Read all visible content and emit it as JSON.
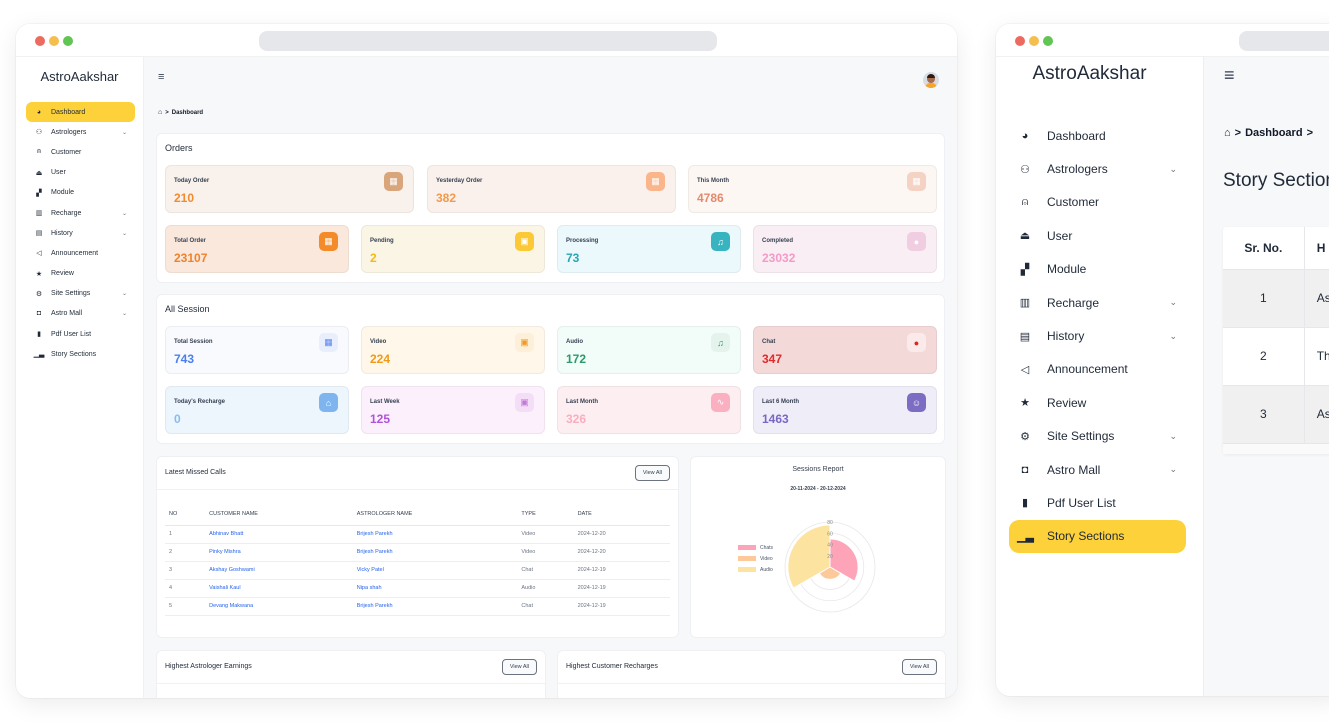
{
  "app": {
    "brand": "AstroAakshar"
  },
  "sidebar": {
    "items": [
      {
        "label": "Dashboard",
        "icon": "tachometer-icon",
        "glyph": "◕",
        "expandable": false
      },
      {
        "label": "Astrologers",
        "icon": "users-icon",
        "glyph": "⚇",
        "expandable": true
      },
      {
        "label": "Customer",
        "icon": "user-tie-icon",
        "glyph": "⍝",
        "expandable": false
      },
      {
        "label": "User",
        "icon": "user-icon",
        "glyph": "⏏",
        "expandable": false
      },
      {
        "label": "Module",
        "icon": "sitemap-icon",
        "glyph": "▞",
        "expandable": false
      },
      {
        "label": "Recharge",
        "icon": "money-icon",
        "glyph": "▥",
        "expandable": true
      },
      {
        "label": "History",
        "icon": "clipboard-history-icon",
        "glyph": "▤",
        "expandable": true
      },
      {
        "label": "Announcement",
        "icon": "megaphone-icon",
        "glyph": "◁",
        "expandable": false
      },
      {
        "label": "Review",
        "icon": "star-icon",
        "glyph": "★",
        "expandable": false
      },
      {
        "label": "Site Settings",
        "icon": "gear-icon",
        "glyph": "⚙",
        "expandable": true
      },
      {
        "label": "Astro Mall",
        "icon": "shield-icon",
        "glyph": "◘",
        "expandable": true
      },
      {
        "label": "Pdf User List",
        "icon": "file-icon",
        "glyph": "▮",
        "expandable": false
      },
      {
        "label": "Story Sections",
        "icon": "bar-chart-icon",
        "glyph": "▁▃",
        "expandable": false
      }
    ],
    "chevron": "⌄"
  },
  "windowA": {
    "active_item": "Dashboard",
    "menu_glyph": "≡",
    "breadcrumb": {
      "home_glyph": "⌂",
      "separator": ">",
      "items": [
        "Dashboard"
      ]
    },
    "orders": {
      "title": "Orders",
      "cards": [
        {
          "label": "Today Order",
          "value": "210",
          "icon": "calendar-icon",
          "glyph": "▦",
          "bg": "#f8f1ec",
          "color": "#f08b2f",
          "icon_bg": "#d9a57a"
        },
        {
          "label": "Yesterday Order",
          "value": "382",
          "icon": "calendar-icon",
          "glyph": "▦",
          "bg": "#fbf1ec",
          "color": "#f29a4a",
          "icon_bg": "#fbb58a"
        },
        {
          "label": "This Month",
          "value": "4786",
          "icon": "calendar-icon",
          "glyph": "▦",
          "bg": "#fdf7f4",
          "color": "#e48a6b",
          "icon_bg": "#f4d3c5"
        },
        {
          "label": "Total Order",
          "value": "23107",
          "icon": "calendar-icon",
          "glyph": "▦",
          "bg": "#fae8dc",
          "color": "#f0822a",
          "icon_bg": "#f38b2b"
        },
        {
          "label": "Pending",
          "value": "2",
          "icon": "video-icon",
          "glyph": "▣",
          "bg": "#fbf5e6",
          "color": "#f6b90f",
          "icon_bg": "#fbc938"
        },
        {
          "label": "Processing",
          "value": "73",
          "icon": "audio-file-icon",
          "glyph": "♫",
          "bg": "#ebf8fc",
          "color": "#27a7b5",
          "icon_bg": "#38b3c0"
        },
        {
          "label": "Completed",
          "value": "23032",
          "icon": "chat-icon",
          "glyph": "●",
          "bg": "#f9eef4",
          "color": "#f59ac8",
          "icon_bg": "#f1cde2"
        }
      ]
    },
    "sessions": {
      "title": "All Session",
      "cards": [
        {
          "label": "Total Session",
          "value": "743",
          "icon": "calendar-icon",
          "glyph": "▦",
          "bg": "#f8fafd",
          "color": "#4a7ff0",
          "icon_bg": "#e8eefb",
          "icon_fg": "#5b86f0"
        },
        {
          "label": "Video",
          "value": "224",
          "icon": "video-icon",
          "glyph": "▣",
          "bg": "#fef7ea",
          "color": "#f09a16",
          "icon_bg": "#fdefd8",
          "icon_fg": "#f39a20"
        },
        {
          "label": "Audio",
          "value": "172",
          "icon": "audio-file-icon",
          "glyph": "♫",
          "bg": "#f2fcf8",
          "color": "#2a9b6c",
          "icon_bg": "#e4f4ec",
          "icon_fg": "#2a9b6c"
        },
        {
          "label": "Chat",
          "value": "347",
          "icon": "chat-icon",
          "glyph": "●",
          "bg": "#f4d9d9",
          "color": "#e12a2a",
          "icon_bg": "#fbeaea",
          "icon_fg": "#e02424"
        },
        {
          "label": "Today's Recharge",
          "value": "0",
          "icon": "bank-icon",
          "glyph": "⌂",
          "bg": "#edf5fd",
          "color": "#86bdf0",
          "icon_bg": "#7fb5ee",
          "icon_fg": "#ffffff"
        },
        {
          "label": "Last Week",
          "value": "125",
          "icon": "calendar-play-icon",
          "glyph": "▣",
          "bg": "#fbf0fc",
          "color": "#b053d8",
          "icon_bg": "#f4def7",
          "icon_fg": "#c47ad8"
        },
        {
          "label": "Last Month",
          "value": "326",
          "icon": "trend-line-icon",
          "glyph": "∿",
          "bg": "#fdeff1",
          "color": "#f8aec0",
          "icon_bg": "#fbb0c1",
          "icon_fg": "#ffffff"
        },
        {
          "label": "Last 6 Month",
          "value": "1463",
          "icon": "support-agent-icon",
          "glyph": "☺",
          "bg": "#efedf8",
          "color": "#7a66c4",
          "icon_bg": "#7d6cc4",
          "icon_fg": "#ffffff"
        }
      ]
    },
    "missed_calls": {
      "title": "Latest Missed Calls",
      "view_all": "View All",
      "columns": [
        "NO",
        "CUSTOMER NAME",
        "ASTROLOGER NAME",
        "TYPE",
        "DATE"
      ],
      "rows": [
        [
          "1",
          "Abhinav Bhatt",
          "Brijesh Parekh",
          "Video",
          "2024-12-20"
        ],
        [
          "2",
          "Pinky Mishra",
          "Brijesh Parekh",
          "Video",
          "2024-12-20"
        ],
        [
          "3",
          "Akshay Goshwami",
          "Vicky Patel",
          "Chat",
          "2024-12-19"
        ],
        [
          "4",
          "Vaishali Kaul",
          "Nipa shah",
          "Audio",
          "2024-12-19"
        ],
        [
          "5",
          "Devang Makwana",
          "Brijesh Parekh",
          "Chat",
          "2024-12-19"
        ]
      ]
    },
    "earnings": {
      "title": "Highest Astrologer Earnings",
      "view_all": "View All"
    },
    "recharges": {
      "title": "Highest Customer Recharges",
      "view_all": "View All"
    }
  },
  "chart_data": {
    "type": "polarArea",
    "title": "Sessions Report",
    "subtitle": "20-11-2024 - 20-12-2024",
    "categories": [
      "Chats",
      "Video",
      "Audio"
    ],
    "values": [
      50,
      22,
      75
    ],
    "colors": [
      "#fda4b8",
      "#fdc99a",
      "#fde3a0"
    ],
    "r_ticks": [
      "20",
      "40",
      "60",
      "80"
    ],
    "rlim": [
      0,
      80
    ],
    "legend": "left"
  },
  "windowB": {
    "active_item": "Story Sections",
    "menu_glyph": "≡",
    "breadcrumb": {
      "home_glyph": "⌂",
      "separator": ">",
      "items": [
        "Dashboard",
        ">"
      ]
    },
    "title": "Story Sections",
    "table": {
      "columns": [
        "Sr. No.",
        "H"
      ],
      "rows": [
        [
          "1",
          "As"
        ],
        [
          "2",
          "Th"
        ],
        [
          "3",
          "As"
        ]
      ]
    }
  }
}
